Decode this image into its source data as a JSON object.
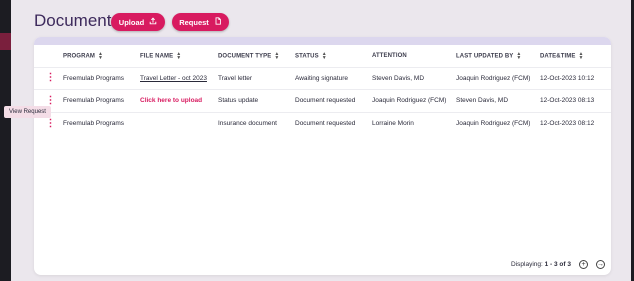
{
  "page_title": "Documents",
  "buttons": {
    "upload": "Upload",
    "request": "Request"
  },
  "table": {
    "headers": [
      "PROGRAM",
      "FILE NAME",
      "DOCUMENT TYPE",
      "STATUS",
      "ATTENTION",
      "LAST UPDATED BY",
      "DATE&TIME"
    ],
    "rows": [
      {
        "program": "Freemulab Programs",
        "file_name": "Travel Letter - oct 2023",
        "document_type": "Travel letter",
        "status": "Awaiting signature",
        "attention": "Steven Davis, MD",
        "last_updated_by": "Joaquin Rodriguez (FCM)",
        "date_time": "12-Oct-2023 10:12"
      },
      {
        "program": "Freemulab Programs",
        "file_name": "Click here to upload",
        "document_type": "Status update",
        "status": "Document requested",
        "attention": "Joaquin Rodriguez (FCM)",
        "last_updated_by": "Steven Davis, MD",
        "date_time": "12-Oct-2023 08:13"
      },
      {
        "program": "Freemulab Programs",
        "file_name": "",
        "document_type": "Insurance document",
        "status": "Document requested",
        "attention": "Lorraine Morin",
        "last_updated_by": "Joaquin Rodriguez (FCM)",
        "date_time": "12-Oct-2023 08:12"
      }
    ]
  },
  "footer": {
    "displaying_label": "Displaying:",
    "range": "1 - 3 of 3"
  },
  "tooltip": "View Request",
  "colors": {
    "accent": "#d81b60",
    "title": "#3d2a5c",
    "background": "#ebe7ed"
  },
  "icons": [
    "upload-icon",
    "document-icon",
    "sort-icon",
    "kebab-menu-icon",
    "add-circle-icon",
    "arrow-right-circle-icon"
  ]
}
